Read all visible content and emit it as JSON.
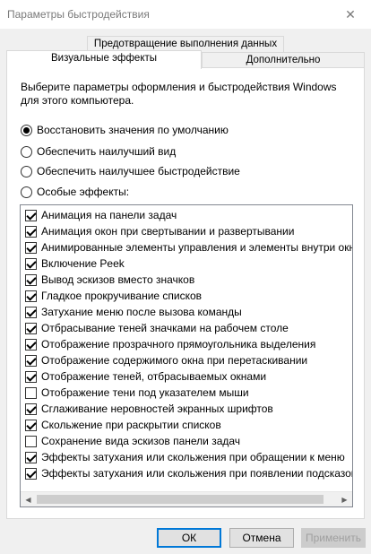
{
  "window": {
    "title": "Параметры быстродействия",
    "close_glyph": "✕"
  },
  "tabs": [
    {
      "label": "Предотвращение выполнения данных",
      "active": false
    },
    {
      "label": "Визуальные эффекты",
      "active": true
    },
    {
      "label": "Дополнительно",
      "active": false
    }
  ],
  "description": "Выберите параметры оформления и быстродействия Windows для этого компьютера.",
  "radios": [
    {
      "label": "Восстановить значения по умолчанию",
      "selected": true
    },
    {
      "label": "Обеспечить наилучший вид",
      "selected": false
    },
    {
      "label": "Обеспечить наилучшее быстродействие",
      "selected": false
    },
    {
      "label": "Особые эффекты:",
      "selected": false
    }
  ],
  "effects": [
    {
      "label": "Анимация на панели задач",
      "checked": true
    },
    {
      "label": "Анимация окон при свертывании и развертывании",
      "checked": true
    },
    {
      "label": "Анимированные элементы управления и элементы внутри окна",
      "checked": true
    },
    {
      "label": "Включение Peek",
      "checked": true
    },
    {
      "label": "Вывод эскизов вместо значков",
      "checked": true
    },
    {
      "label": "Гладкое прокручивание списков",
      "checked": true
    },
    {
      "label": "Затухание меню после вызова команды",
      "checked": true
    },
    {
      "label": "Отбрасывание теней значками на рабочем столе",
      "checked": true
    },
    {
      "label": "Отображение прозрачного прямоугольника выделения",
      "checked": true
    },
    {
      "label": "Отображение содержимого окна при перетаскивании",
      "checked": true
    },
    {
      "label": "Отображение теней, отбрасываемых окнами",
      "checked": true
    },
    {
      "label": "Отображение тени под указателем мыши",
      "checked": false
    },
    {
      "label": "Сглаживание неровностей экранных шрифтов",
      "checked": true
    },
    {
      "label": "Скольжение при раскрытии списков",
      "checked": true
    },
    {
      "label": "Сохранение вида эскизов панели задач",
      "checked": false
    },
    {
      "label": "Эффекты затухания или скольжения при обращении к меню",
      "checked": true
    },
    {
      "label": "Эффекты затухания или скольжения при появлении подсказок",
      "checked": true
    }
  ],
  "scrollbar": {
    "left_arrow": "◀",
    "right_arrow": "▶"
  },
  "buttons": {
    "ok": "ОК",
    "cancel": "Отмена",
    "apply": "Применить"
  }
}
